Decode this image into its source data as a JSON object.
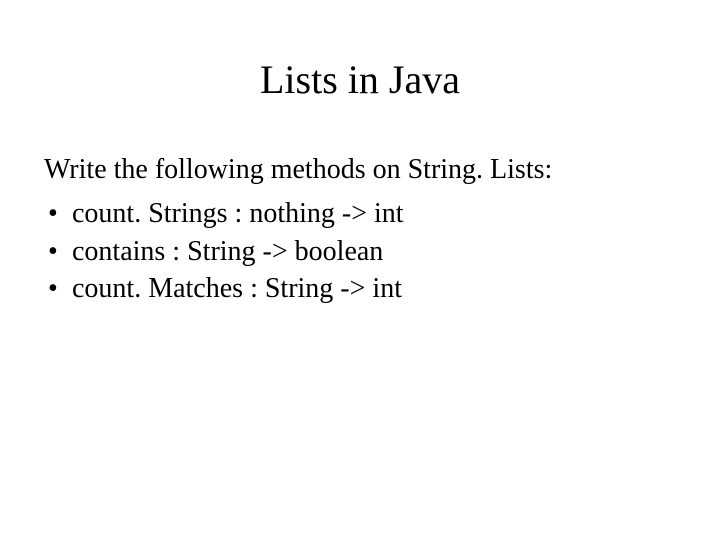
{
  "title": "Lists in Java",
  "intro": "Write the following methods on String. Lists:",
  "bullets": [
    "count. Strings : nothing -> int",
    "contains : String -> boolean",
    "count. Matches : String -> int"
  ]
}
